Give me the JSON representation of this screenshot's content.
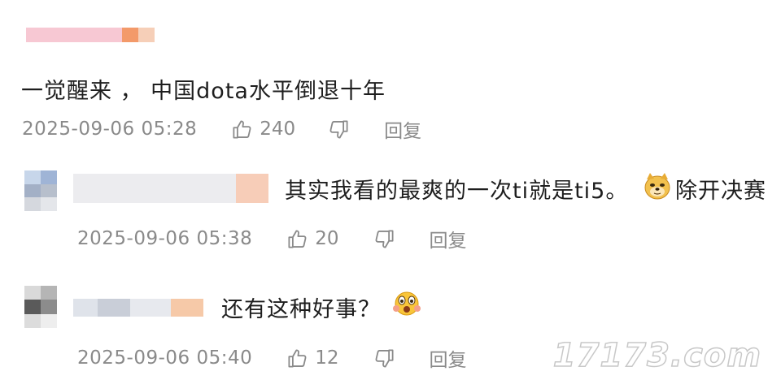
{
  "comments": [
    {
      "text": "一觉醒来 ， 中国dota水平倒退十年",
      "time": "2025-09-06 05:28",
      "likes": "240",
      "reply_label": "回复"
    },
    {
      "text": "其实我看的最爽的一次ti就是ti5。",
      "text_after_emoji": "除开决赛",
      "emoji": "doge-icon",
      "time": "2025-09-06 05:38",
      "likes": "20",
      "reply_label": "回复"
    },
    {
      "text": "还有这种好事？",
      "emoji": "shocked-face-icon",
      "time": "2025-09-06 05:40",
      "likes": "12",
      "reply_label": "回复"
    }
  ],
  "watermark": "17173.com",
  "colors": {
    "text": "#1e1e1e",
    "meta": "#8a8a8a",
    "blur_pink": "#f6c8d0",
    "blur_orange": "#f3a06a"
  }
}
